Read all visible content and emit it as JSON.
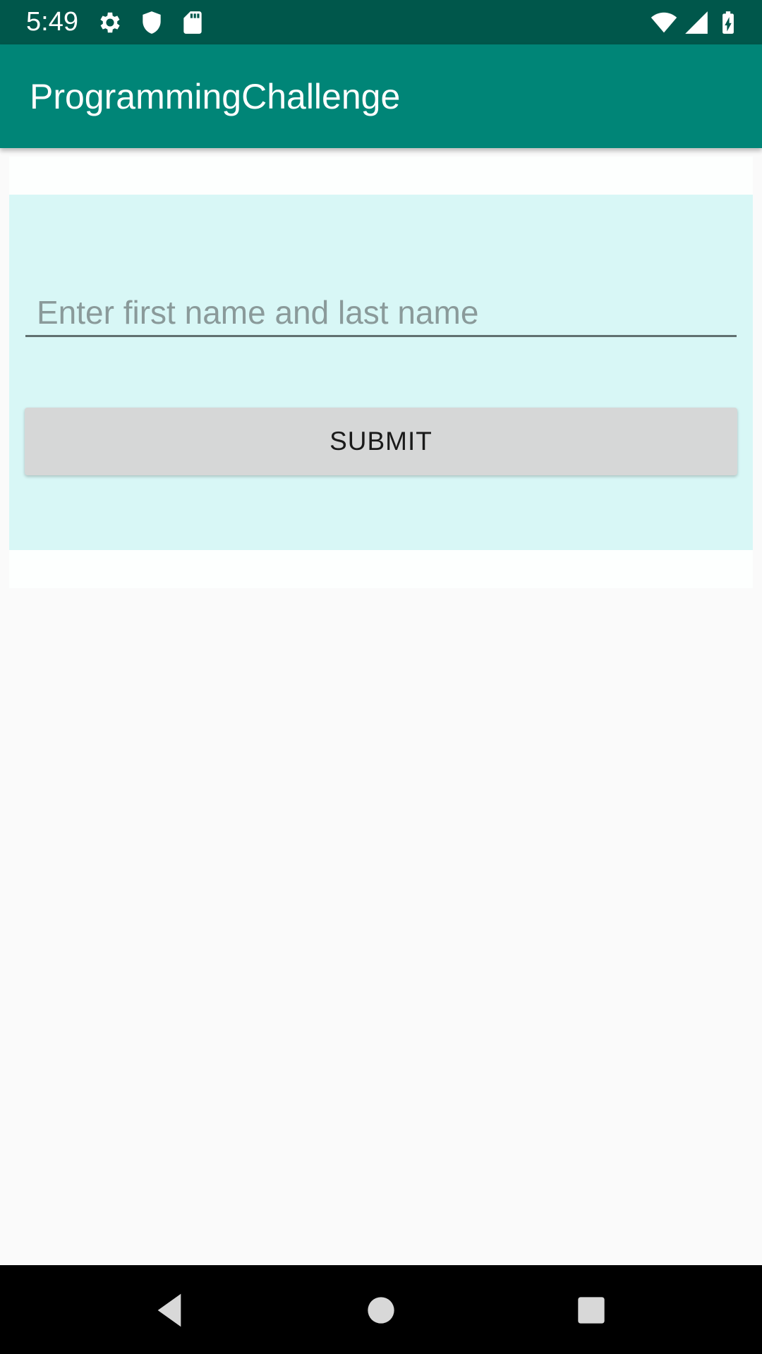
{
  "status_bar": {
    "time": "5:49",
    "background": "#00574b",
    "icons_left": [
      "gear-icon",
      "shield-icon",
      "sd-card-icon"
    ],
    "icons_right": [
      "wifi-icon",
      "signal-icon",
      "battery-charging-icon"
    ]
  },
  "app_bar": {
    "title": "ProgrammingChallenge",
    "background": "#008577"
  },
  "form": {
    "panel_color": "#d8f7f6",
    "name_field": {
      "value": "",
      "placeholder": "Enter first name and last name"
    },
    "submit_label": "SUBMIT"
  },
  "nav_bar": {
    "buttons": [
      "back-icon",
      "home-icon",
      "recents-icon"
    ]
  }
}
